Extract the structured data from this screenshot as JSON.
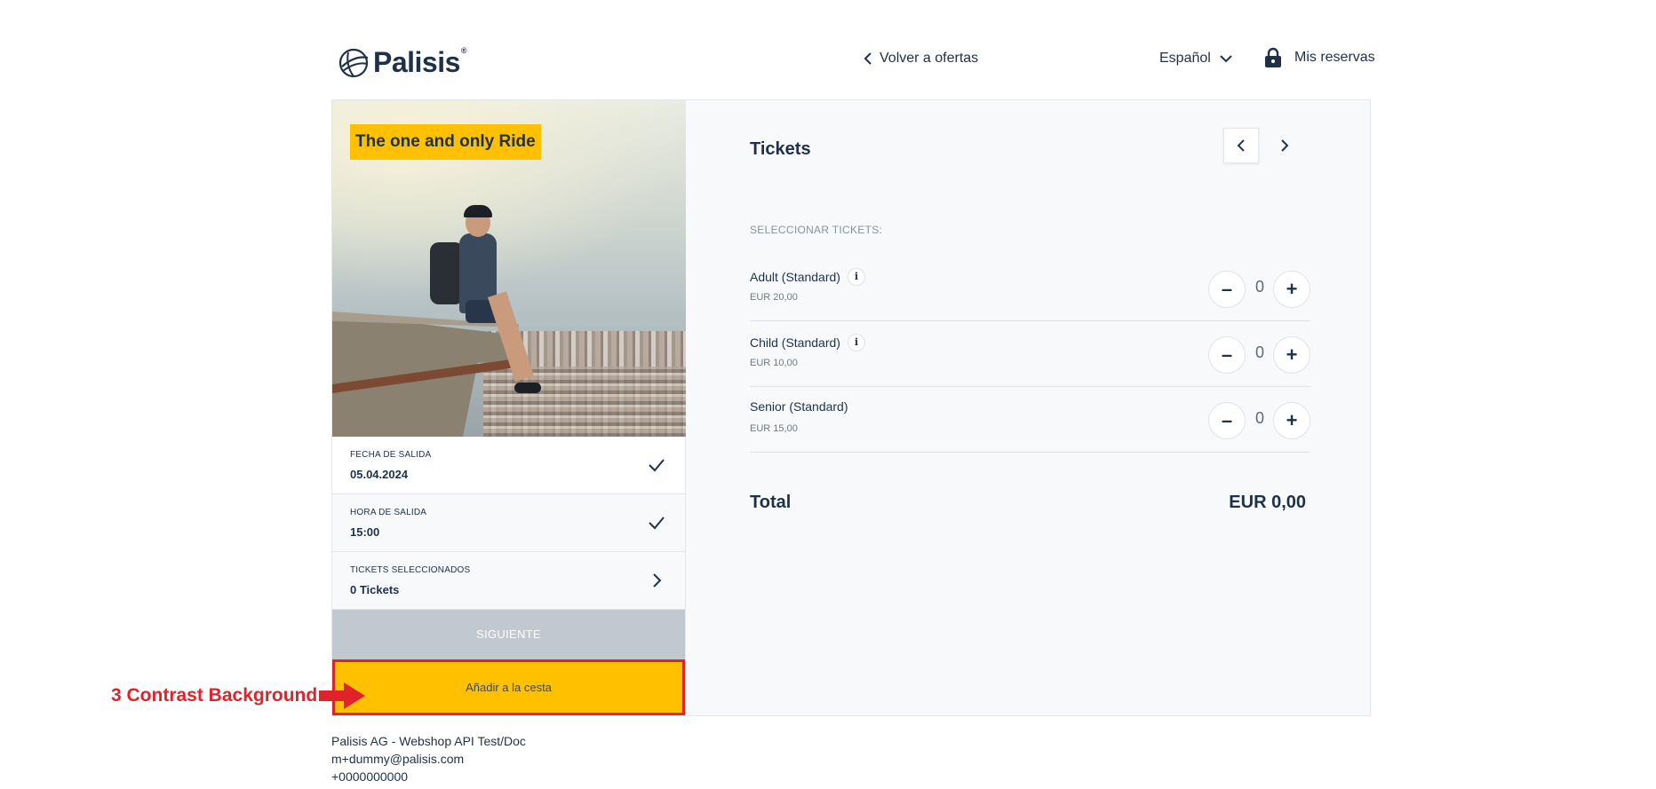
{
  "header": {
    "logo_text": "Palisis",
    "logo_reg": "®",
    "back_link": "Volver a ofertas",
    "language": "Español",
    "reservations": "Mis reservas"
  },
  "left": {
    "hero_title": "The one and only Ride",
    "steps": [
      {
        "label": "FECHA DE SALIDA",
        "value": "05.04.2024",
        "icon": "check-icon"
      },
      {
        "label": "HORA DE SALIDA",
        "value": "15:00",
        "icon": "check-icon"
      },
      {
        "label": "TICKETS SELECCIONADOS",
        "value": "0 Tickets",
        "icon": "chevron-right-icon"
      }
    ],
    "next_button": "SIGUIENTE",
    "cart_button": "Añadir a la cesta"
  },
  "right": {
    "title": "Tickets",
    "section_label": "SELECCIONAR TICKETS:",
    "tickets": [
      {
        "name": "Adult (Standard)",
        "price": "EUR 20,00",
        "qty": "0",
        "has_info": true
      },
      {
        "name": "Child (Standard)",
        "price": "EUR 10,00",
        "qty": "0",
        "has_info": true
      },
      {
        "name": "Senior (Standard)",
        "price": "EUR 15,00",
        "qty": "0",
        "has_info": false
      }
    ],
    "minus_label": "–",
    "plus_label": "+",
    "info_label": "i",
    "total_label": "Total",
    "total_value": "EUR 0,00"
  },
  "footer": {
    "company": "Palisis AG - Webshop API Test/Doc",
    "email": "m+dummy@palisis.com",
    "phone": "+0000000000"
  },
  "annotation": {
    "text": "3 Contrast Background",
    "color": "#e0232b"
  },
  "colors": {
    "brand_dark": "#1f3148",
    "accent_yellow": "#ffc000",
    "disabled_gray": "#c2c8d0",
    "highlight_red": "#e0232b"
  }
}
